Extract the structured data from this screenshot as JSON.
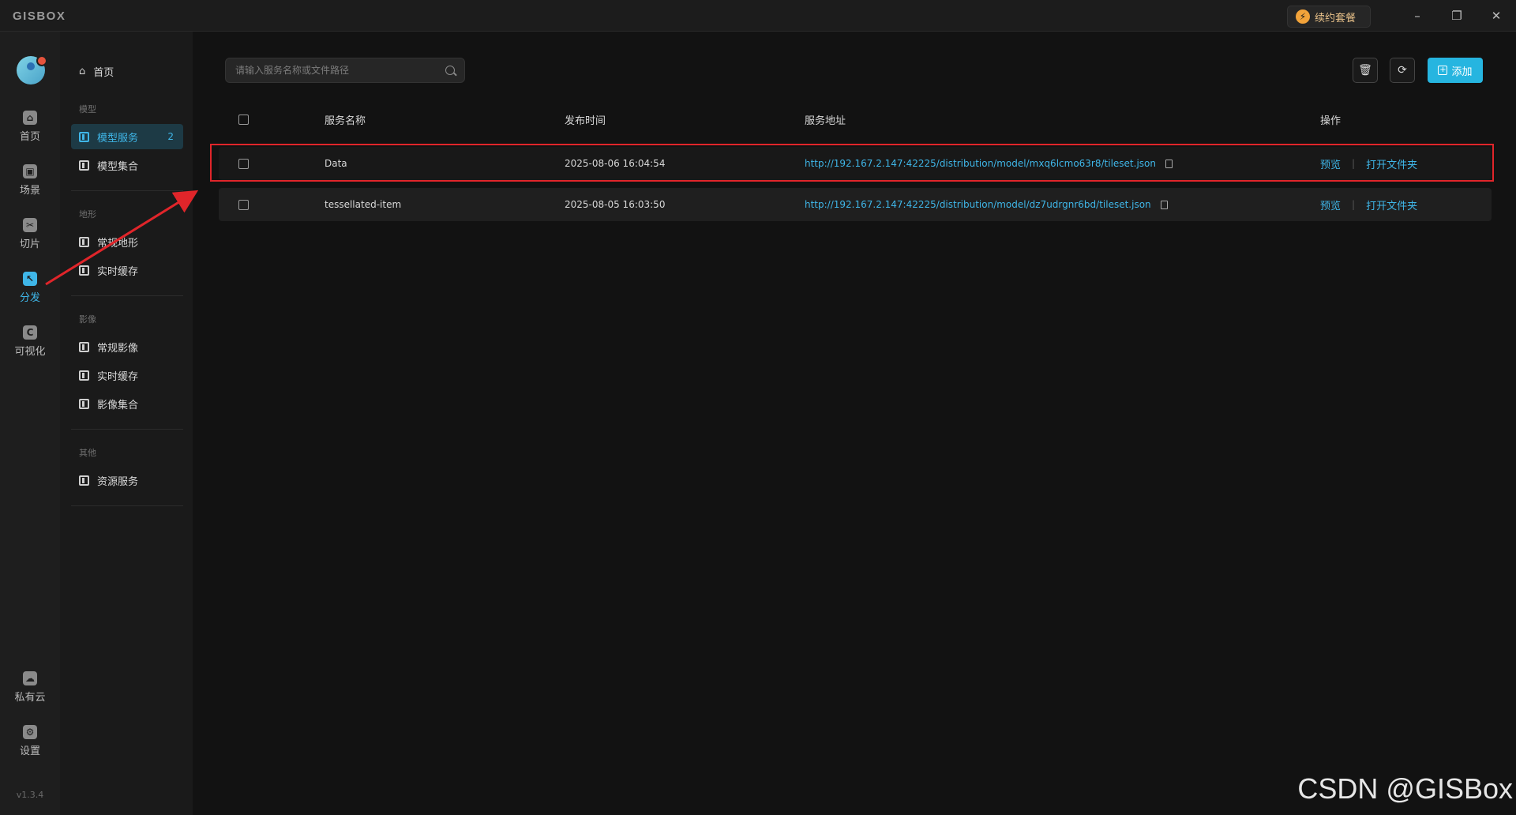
{
  "app": {
    "logo": "GISBOX",
    "renew_label": "续约套餐",
    "renew_icon": "⚡"
  },
  "window": {
    "minimize": "–",
    "restore": "❐",
    "close": "✕"
  },
  "rail": {
    "items": [
      {
        "label": "首页",
        "icon": "⌂",
        "icon_name": "home-icon"
      },
      {
        "label": "场景",
        "icon": "▣",
        "icon_name": "scene-icon"
      },
      {
        "label": "切片",
        "icon": "✂",
        "icon_name": "slice-icon"
      },
      {
        "label": "分发",
        "icon": "↖",
        "icon_name": "distribute-icon"
      },
      {
        "label": "可视化",
        "icon": "C",
        "icon_name": "visualize-icon"
      }
    ],
    "bottom_items": [
      {
        "label": "私有云",
        "icon": "☁",
        "icon_name": "private-cloud-icon"
      },
      {
        "label": "设置",
        "icon": "⚙",
        "icon_name": "settings-icon"
      }
    ],
    "version": "v1.3.4"
  },
  "menu": {
    "home": "首页",
    "groups": [
      {
        "title": "模型",
        "items": [
          {
            "label": "模型服务",
            "count": "2"
          },
          {
            "label": "模型集合"
          }
        ]
      },
      {
        "title": "地形",
        "items": [
          {
            "label": "常规地形"
          },
          {
            "label": "实时缓存"
          }
        ]
      },
      {
        "title": "影像",
        "items": [
          {
            "label": "常规影像"
          },
          {
            "label": "实时缓存"
          },
          {
            "label": "影像集合"
          }
        ]
      },
      {
        "title": "其他",
        "items": [
          {
            "label": "资源服务"
          }
        ]
      }
    ]
  },
  "search": {
    "placeholder": "请输入服务名称或文件路径"
  },
  "toolbar": {
    "delete_icon": "🗑",
    "refresh_icon": "⟳",
    "add_label": "添加",
    "add_icon": "+"
  },
  "table": {
    "headers": {
      "name": "服务名称",
      "time": "发布时间",
      "url": "服务地址",
      "ops": "操作"
    },
    "rows": [
      {
        "name": "Data",
        "time": "2025-08-06 16:04:54",
        "url": "http://192.167.2.147:42225/distribution/model/mxq6lcmo63r8/tileset.json",
        "preview": "预览",
        "open": "打开文件夹"
      },
      {
        "name": "tessellated-item",
        "time": "2025-08-05 16:03:50",
        "url": "http://192.167.2.147:42225/distribution/model/dz7udrgnr6bd/tileset.json",
        "preview": "预览",
        "open": "打开文件夹"
      }
    ],
    "separator": "|"
  },
  "watermark": "CSDN @GISBox",
  "colors": {
    "accent": "#3fb6e8",
    "add_button": "#26b5e0",
    "highlight": "#e0252a"
  }
}
